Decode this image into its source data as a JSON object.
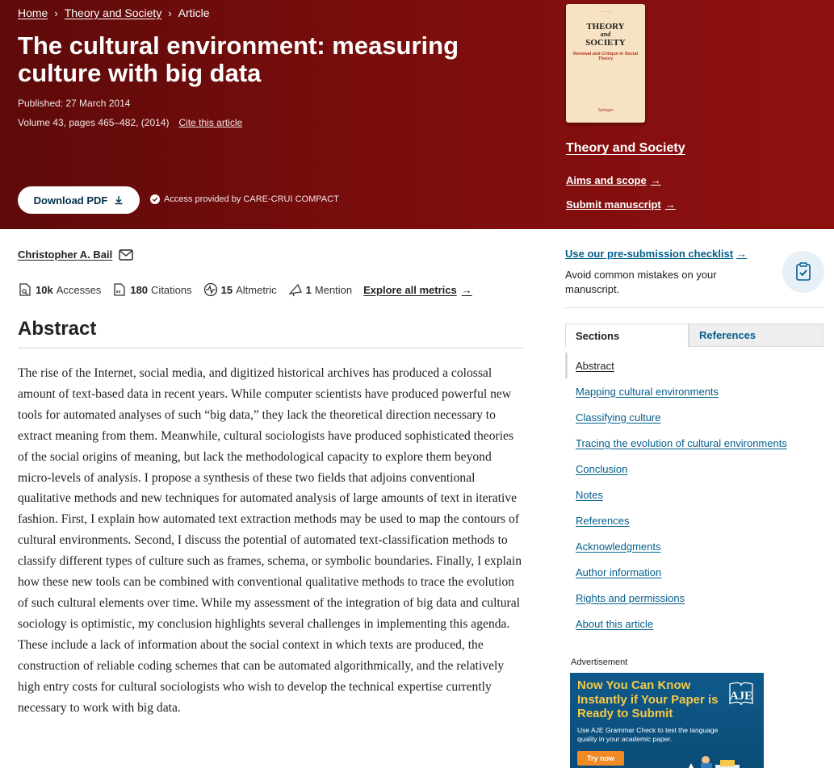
{
  "breadcrumb": {
    "home": "Home",
    "journal": "Theory and Society",
    "current": "Article"
  },
  "article": {
    "title": "The cultural environment: measuring culture with big data",
    "published": "Published: 27 March 2014",
    "volume": "Volume 43, pages 465–482, (2014)",
    "cite_label": "Cite this article",
    "download_label": "Download PDF",
    "access": "Access provided by CARE-CRUI COMPACT"
  },
  "journal": {
    "name": "Theory and Society",
    "cover_title_top": "THEORY",
    "cover_title_mid": "and",
    "cover_title_bottom": "SOCIETY",
    "cover_subtitle": "Renewal and Critique in Social Theory",
    "cover_publisher": "Springer",
    "aims_label": "Aims and scope",
    "submit_label": "Submit manuscript"
  },
  "author": {
    "name": "Christopher A. Bail"
  },
  "metrics": {
    "accesses_value": "10k",
    "accesses_label": "Accesses",
    "citations_value": "180",
    "citations_label": "Citations",
    "altmetric_value": "15",
    "altmetric_label": "Altmetric",
    "mention_value": "1",
    "mention_label": "Mention",
    "explore_label": "Explore all metrics"
  },
  "abstract": {
    "heading": "Abstract",
    "text": "The rise of the Internet, social media, and digitized historical archives has produced a colossal amount of text-based data in recent years. While computer scientists have produced powerful new tools for automated analyses of such “big data,” they lack the theoretical direction necessary to extract meaning from them. Meanwhile, cultural sociologists have produced sophisticated theories of the social origins of meaning, but lack the methodological capacity to explore them beyond micro-levels of analysis. I propose a synthesis of these two fields that adjoins conventional qualitative methods and new techniques for automated analysis of large amounts of text in iterative fashion. First, I explain how automated text extraction methods may be used to map the contours of cultural environments. Second, I discuss the potential of automated text-classification methods to classify different types of culture such as frames, schema, or symbolic boundaries. Finally, I explain how these new tools can be combined with conventional qualitative methods to trace the evolution of such cultural elements over time. While my assessment of the integration of big data and cultural sociology is optimistic, my conclusion highlights several challenges in implementing this agenda. These include a lack of information about the social context in which texts are produced, the construction of reliable coding schemes that can be automated algorithmically, and the relatively high entry costs for cultural sociologists who wish to develop the technical expertise currently necessary to work with big data."
  },
  "sidebar": {
    "checklist_link": "Use our pre-submission checklist",
    "checklist_desc": "Avoid common mistakes on your manuscript.",
    "tabs": [
      "Sections",
      "References"
    ],
    "sections": [
      "Abstract",
      "Mapping cultural environments",
      "Classifying culture",
      "Tracing the evolution of cultural environments",
      "Conclusion",
      "Notes",
      "References",
      "Acknowledgments",
      "Author information",
      "Rights and permissions",
      "About this article"
    ],
    "ad_label": "Advertisement",
    "ad": {
      "headline": "Now You Can Know Instantly if Your Paper is Ready to Submit",
      "logo": "AJE",
      "body": "Use AJE Grammar Check to test the language quality in your academic paper.",
      "button": "Try now"
    }
  },
  "colors": {
    "header_bg": "#7a0d0d",
    "link": "#025e8d",
    "ad_accent": "#f7c948"
  }
}
